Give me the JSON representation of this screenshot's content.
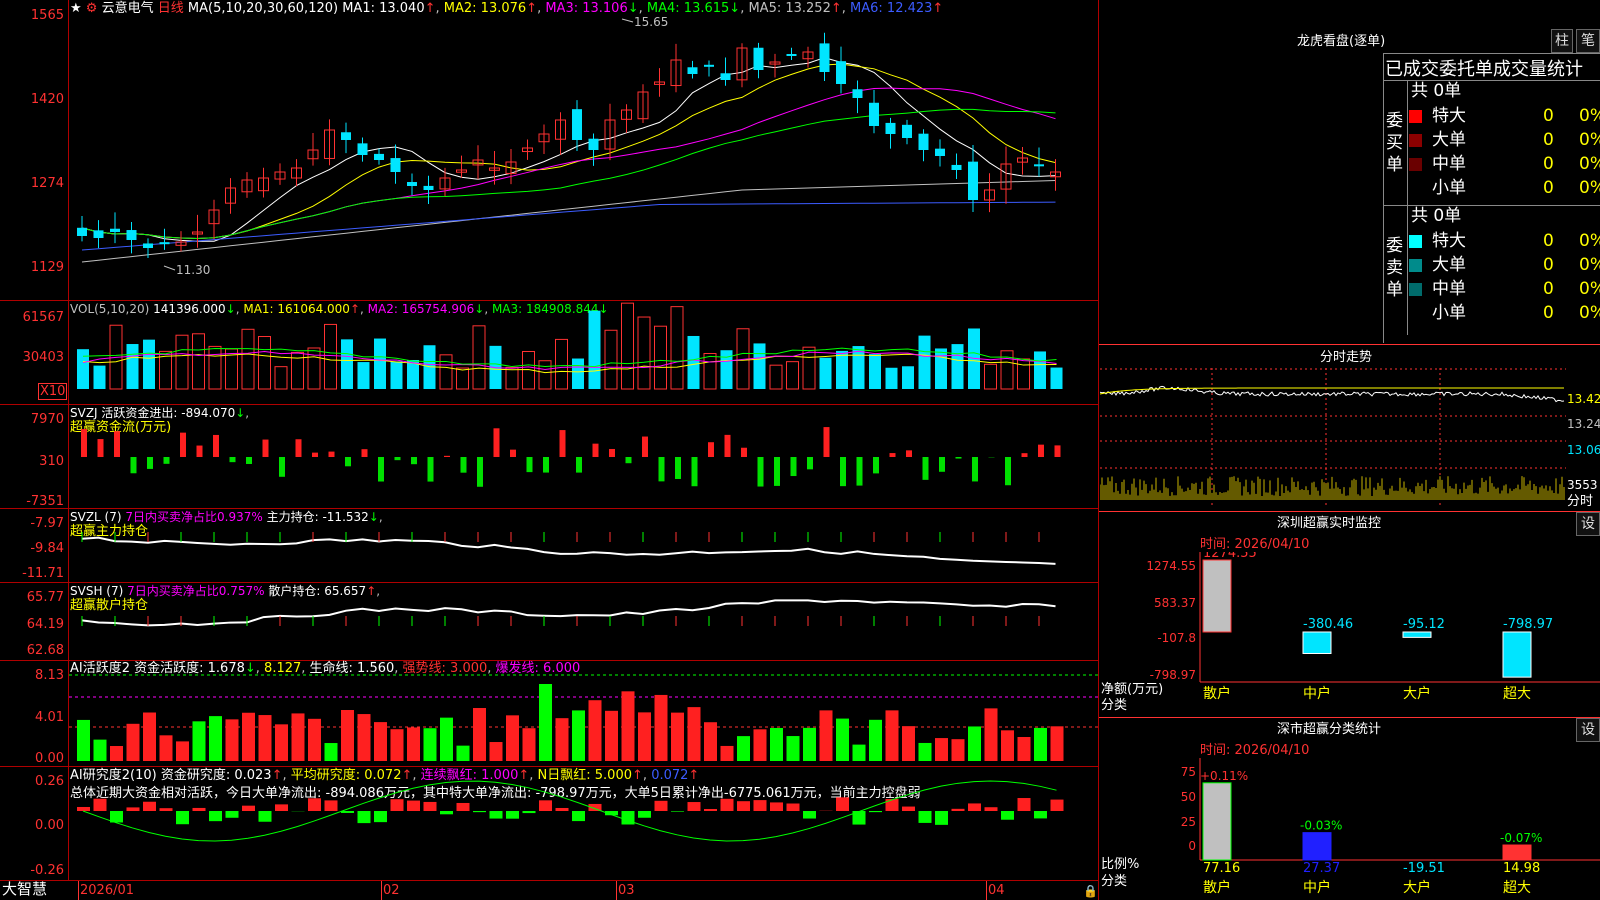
{
  "colors": {
    "bg": "#000000",
    "up": "#ff3232",
    "down": "#00e5ff",
    "grid": "#b00000",
    "ma1": "#ffffff",
    "ma2": "#ffff00",
    "ma3": "#ff00ff",
    "ma4": "#00ff00",
    "ma5": "#c0c0c0",
    "ma6": "#3c5cff"
  },
  "icons": {
    "star": "★",
    "gear": "⚙",
    "lock": "🔒"
  },
  "header": {
    "stock": "云意电气",
    "period": "日线",
    "ma_def": "MA(5,10,20,30,60,120)",
    "ma1": "MA1: 13.040",
    "ma2": "MA2: 13.076",
    "ma3": "MA3: 13.106",
    "ma4": "MA4: 13.615",
    "ma5": "MA5: 13.252",
    "ma6": "MA6: 12.423",
    "arrow_up": "↑",
    "arrow_down": "↓",
    "high_mark": "15.65",
    "low_mark": "11.30"
  },
  "price_axis": [
    "1565",
    "1420",
    "1274",
    "1129"
  ],
  "vol": {
    "title": "VOL(5,10,20)",
    "value": "141396.000",
    "ma1": "MA1: 161064.000",
    "ma2": "MA2: 165754.906",
    "ma3": "MA3: 184908.844",
    "axis": [
      "61567",
      "30403"
    ],
    "unit": "X10"
  },
  "svzj": {
    "title": "SVZJ",
    "label": "活跃资金进出: -894.070",
    "sub": "超赢资金流(万元)",
    "axis": [
      "7970",
      "310",
      "-7351"
    ]
  },
  "svzl": {
    "title": "SVZL (7)",
    "ratio": "7日内买卖净占比0.937%",
    "hold": "主力持仓: -11.532",
    "sub": "超赢主力持仓",
    "axis": [
      "-7.97",
      "-9.84",
      "-11.71"
    ]
  },
  "svsh": {
    "title": "SVSH (7)",
    "ratio": "7日内买卖净占比0.757%",
    "hold": "散户持仓: 65.657",
    "sub": "超赢散户持仓",
    "axis": [
      "65.77",
      "64.19",
      "62.68"
    ]
  },
  "ai_active": {
    "title": "AI活跃度2",
    "a": "资金活跃度: 1.678",
    "b": "8.127",
    "c": "生命线: 1.560",
    "d": "强势线: 3.000",
    "e": "爆发线: 6.000",
    "axis": [
      "8.13",
      "4.01",
      "0.00"
    ]
  },
  "ai_research": {
    "title": "AI研究度2(10)",
    "a": "资金研究度: 0.023",
    "b": "平均研究度: 0.072",
    "c": "连续飘红: 1.000",
    "d": "N日飘红: 5.000",
    "e": "0.072",
    "summary": "总体近期大资金相对活跃，今日大单净流出: -894.086万元，其中特大单净流出: -798.97万元，大单5日累计净出-6775.061万元，当前主力控盘弱",
    "axis": [
      "0.26",
      "0.00",
      "-0.26"
    ]
  },
  "dates": [
    "2026/01",
    "02",
    "03",
    "04"
  ],
  "brand": "大智慧",
  "right": {
    "title": "龙虎看盘(逐单)",
    "btn1": "柱",
    "btn2": "笔",
    "subtitle": "已成交委托单成交量统计",
    "buy": {
      "side": "委买单",
      "total": "共 0单",
      "rows": [
        {
          "name": "特大",
          "v": "0",
          "p": "0%",
          "c": "#ff0000"
        },
        {
          "name": "大单",
          "v": "0",
          "p": "0%",
          "c": "#8b0000"
        },
        {
          "name": "中单",
          "v": "0",
          "p": "0%",
          "c": "#6a0000"
        },
        {
          "name": "小单",
          "v": "0",
          "p": "0%",
          "c": "#000000"
        }
      ]
    },
    "sell": {
      "side": "委卖单",
      "total": "共 0单",
      "rows": [
        {
          "name": "特大",
          "v": "0",
          "p": "0%",
          "c": "#00ffff"
        },
        {
          "name": "大单",
          "v": "0",
          "p": "0%",
          "c": "#008b8b"
        },
        {
          "name": "中单",
          "v": "0",
          "p": "0%",
          "c": "#006b6b"
        },
        {
          "name": "小单",
          "v": "0",
          "p": "0%",
          "c": "#000000"
        }
      ]
    },
    "intraday": {
      "title": "分时走势",
      "axis": [
        "13.42",
        "13.24",
        "13.06"
      ],
      "vol": "3553",
      "unit": "分时"
    },
    "monitor": {
      "title": "深圳超赢实时监控",
      "btn": "设",
      "time": "时间: 2026/04/10",
      "axis": [
        "1274.55",
        "583.37",
        "-107.8",
        "-798.97"
      ],
      "ylab1": "净额(万元)",
      "ylab2": "分类",
      "cats": [
        "散户",
        "中户",
        "大户",
        "超大"
      ],
      "vals": [
        "1274.55",
        "-380.46",
        "-95.12",
        "-798.97"
      ]
    },
    "classify": {
      "title": "深市超赢分类统计",
      "btn": "设",
      "time": "时间: 2026/04/10",
      "axis": [
        "75",
        "50",
        "25",
        "0"
      ],
      "ylab1": "比例%",
      "ylab2": "分类",
      "cats": [
        "散户",
        "中户",
        "大户",
        "超大"
      ],
      "top": [
        "+0.11%",
        "-0.03%",
        "",
        "-0.07%"
      ],
      "vals": [
        "77.16",
        "27.37",
        "-19.51",
        "14.98"
      ]
    }
  }
}
